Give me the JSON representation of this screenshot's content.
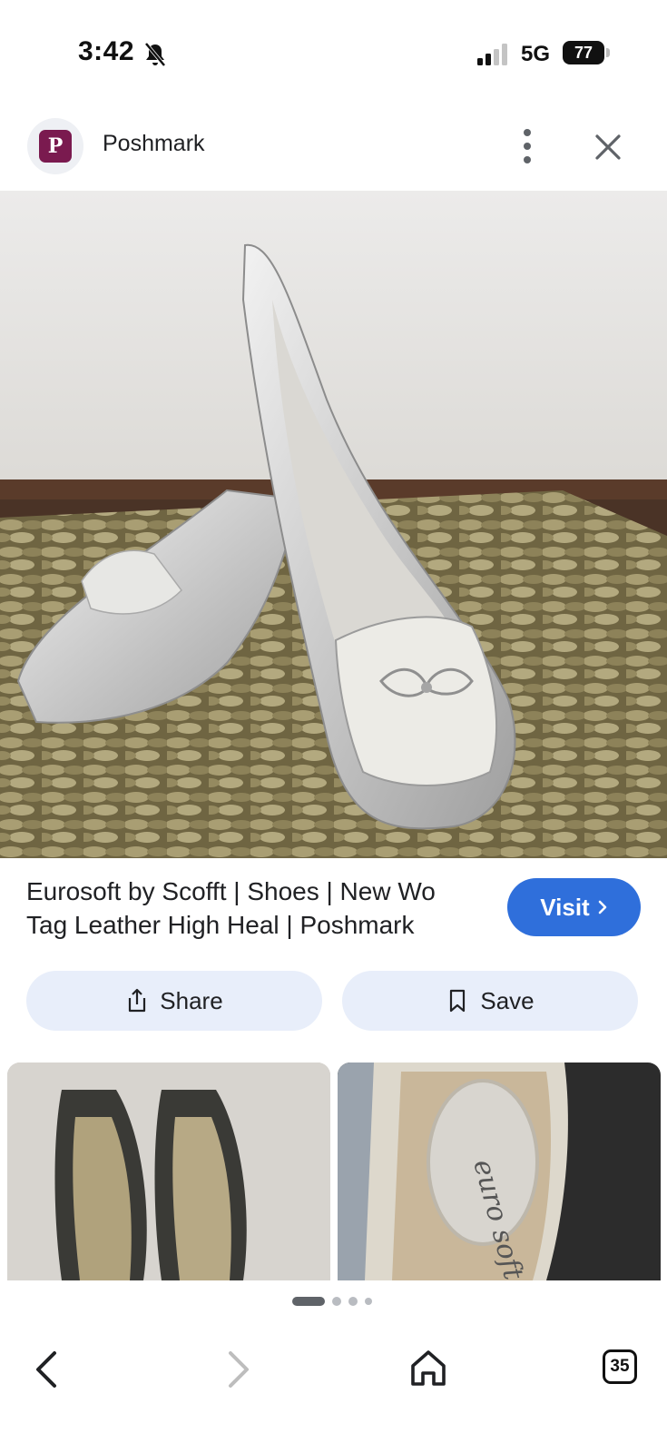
{
  "status_bar": {
    "time": "3:42",
    "network": "5G",
    "battery": "77"
  },
  "header": {
    "site_name": "Poshmark",
    "logo_glyph": "P",
    "more_icon": "more-vert-icon",
    "close_icon": "close-icon"
  },
  "result": {
    "title": "Eurosoft by Scofft | Shoes | New Wo Tag Leather High Heal | Poshmark",
    "visit_label": "Visit"
  },
  "actions": {
    "share_label": "Share",
    "save_label": "Save"
  },
  "pager": {
    "current": 1,
    "total": 4
  },
  "nav": {
    "tab_count": "35"
  },
  "colors": {
    "accent": "#2f6fdb",
    "action_bg": "#e8eefa",
    "logo_bg": "#7a1a4f"
  }
}
